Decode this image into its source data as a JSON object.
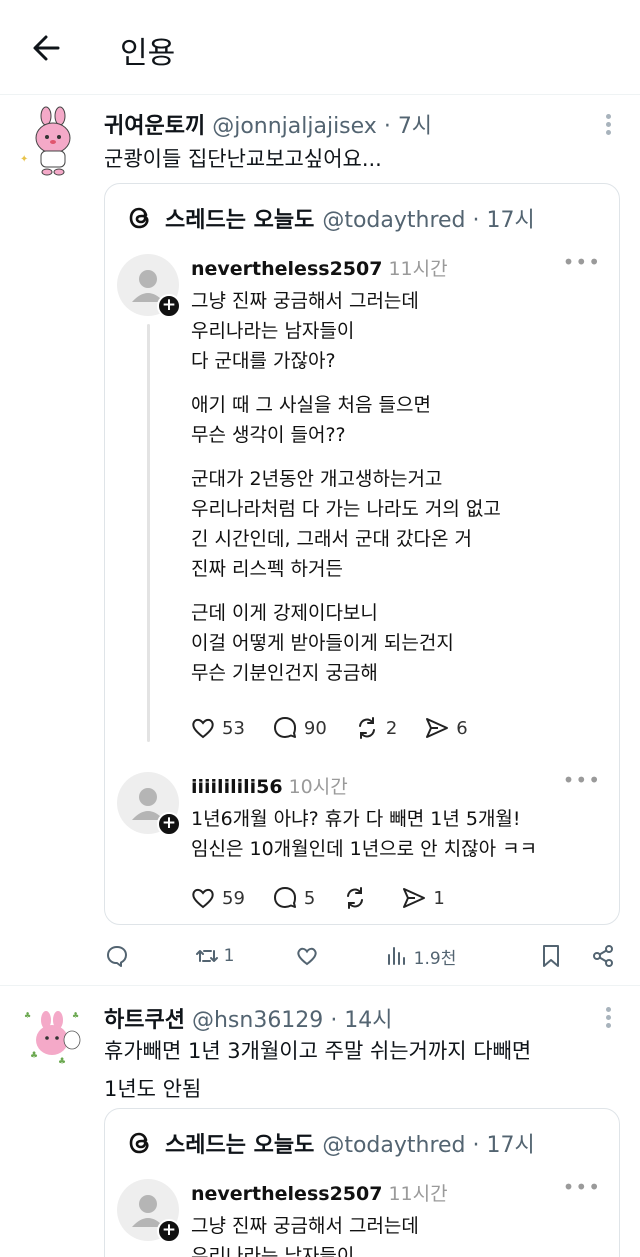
{
  "header": {
    "title": "인용"
  },
  "post1": {
    "display_name": "귀여운토끼",
    "handle": "@jonnjaljajisex",
    "time": "· 7시",
    "text": "군쾅이들 집단난교보고싶어요...",
    "quote": {
      "name": "스레드는 오늘도",
      "handle": "@todaythred · 17시",
      "replies": [
        {
          "username": "nevertheless2507",
          "time": "11시간",
          "paragraphs": [
            [
              "그냥 진짜 궁금해서 그러는데",
              "우리나라는 남자들이",
              "다 군대를 가잖아?"
            ],
            [
              "애기 때 그 사실을 처음 들으면",
              "무슨 생각이 들어??"
            ],
            [
              "군대가 2년동안 개고생하는거고",
              "우리나라처럼 다 가는 나라도 거의 없고",
              "긴 시간인데, 그래서 군대 갔다온 거",
              "진짜 리스펙 하거든"
            ],
            [
              "근데 이게 강제이다보니",
              "이걸 어떻게 받아들이게 되는건지",
              "무슨 기분인건지 궁금해"
            ]
          ],
          "likes": "53",
          "comments": "90",
          "reposts": "2",
          "shares": "6"
        },
        {
          "username": "iiiililili56",
          "time": "10시간",
          "paragraphs": [
            [
              "1년6개월 아냐? 휴가 다 빼면 1년 5개월!",
              "임신은 10개월인데 1년으로 안 치잖아 ㅋㅋ"
            ]
          ],
          "likes": "59",
          "comments": "5",
          "reposts": "",
          "shares": "1"
        }
      ]
    },
    "actions": {
      "replies": "",
      "retweets": "1",
      "likes": "",
      "views": "1.9천"
    }
  },
  "post2": {
    "display_name": "하트쿠션",
    "handle": "@hsn36129",
    "time": "· 14시",
    "text_lines": [
      "휴가빼면 1년 3개월이고 주말 쉬는거까지 다빼면",
      "1년도 안됨"
    ],
    "quote": {
      "name": "스레드는 오늘도",
      "handle": "@todaythred · 17시",
      "reply": {
        "username": "nevertheless2507",
        "time": "11시간",
        "lines": [
          "그냥 진짜 궁금해서 그러는데",
          "우리나라는 남자들이"
        ]
      }
    }
  },
  "colors": {
    "text": "#0f1419",
    "secondary": "#536471",
    "border": "#dfe4e8",
    "avatar_pink": "#f4a9c8"
  }
}
